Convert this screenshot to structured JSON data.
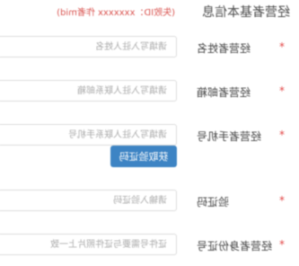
{
  "section": {
    "title": "经营者基本信息",
    "subtitle": "(失败ID：xxxxxxx  作者mid)"
  },
  "form": {
    "rows": [
      {
        "label": "经营者姓名",
        "placeholder": "请填写入驻人姓名"
      },
      {
        "label": "经营者邮箱",
        "placeholder": "请填写入驻人联系邮箱"
      },
      {
        "label": "经营者手机号",
        "placeholder": "请填写入驻人联系手机号"
      },
      {
        "label": "验证码",
        "placeholder": "请输入验证码"
      },
      {
        "label": "经营者身份证号",
        "placeholder": "证件号需要与证件照片上一致"
      }
    ],
    "get_code_label": "获取验证码"
  },
  "colors": {
    "required": "#e24444",
    "button": "#3d84c4",
    "border": "#dcdcdc"
  }
}
